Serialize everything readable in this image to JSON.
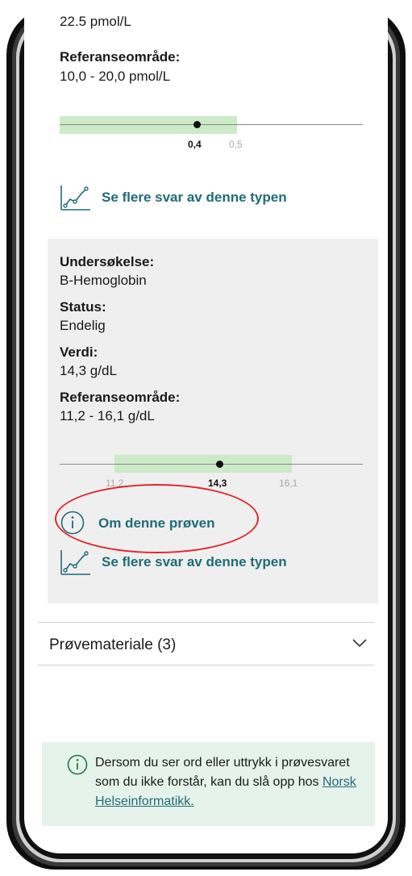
{
  "top_result": {
    "value_partial": "22.5 pmol/L",
    "ref_label": "Referanseområde:",
    "ref_value": "10,0 - 20,0 pmol/L",
    "scale": {
      "marker_label": "0,4",
      "high_label": "0,5"
    },
    "see_more_label": "Se flere svar av denne typen"
  },
  "hemoglobin": {
    "exam_label": "Undersøkelse:",
    "exam_value": "B-Hemoglobin",
    "status_label": "Status:",
    "status_value": "Endelig",
    "value_label": "Verdi:",
    "value": "14,3 g/dL",
    "ref_label": "Referanseområde:",
    "ref_value": "11,2 - 16,1 g/dL",
    "scale": {
      "low_label": "11,2",
      "marker_label": "14,3",
      "high_label": "16,1"
    },
    "about_label": "Om denne prøven",
    "see_more_label": "Se flere svar av denne typen"
  },
  "section": {
    "title": "Prøvemateriale (3)"
  },
  "info": {
    "text": "Dersom du ser ord eller uttrykk i prøvesvaret som du ikke forstår, kan du slå opp hos",
    "link": "Norsk Helseinformatikk."
  },
  "colors": {
    "accent": "#1f6b78",
    "range_band": "#cdeac8",
    "info_bg": "#e6f3ea",
    "annotation": "#e3242b"
  },
  "icons": [
    "trend-chart-icon",
    "info-circle-icon",
    "chevron-down-icon"
  ]
}
